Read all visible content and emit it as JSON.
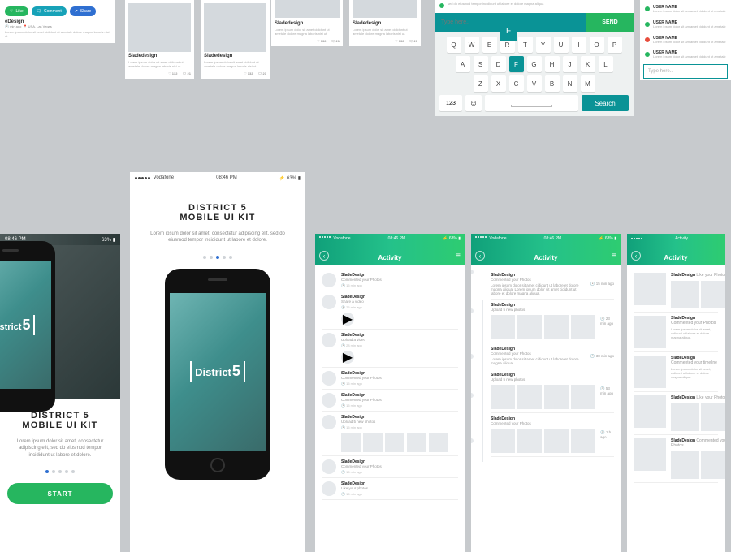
{
  "brand": {
    "name": "District",
    "num": "5",
    "kit_title_1": "DISTRICT 5",
    "kit_title_2": "MOBILE UI KIT",
    "lorem": "Lorem ipsum dolor sit amet, consectetur adipiscing elit, sed do eiusmod tempor incididunt ut labore et dolore.",
    "start": "START"
  },
  "status": {
    "carrier": "Vodafone",
    "time": "08:46 PM",
    "battery": "63%"
  },
  "social": {
    "like": "Like",
    "comment": "Comment",
    "share": "Share",
    "author": "Sladedesign",
    "title2": "eDesign",
    "when": "min ago",
    "loc": "USA, Las Vegas",
    "lorem": "Lorem ipsum dolor sit amet cididunt ut ametale dolore magna laboris nisi ut.",
    "likes": "132",
    "cmts": "21"
  },
  "chat": {
    "placeholder": "Type here..",
    "send": "SEND",
    "lorem": "sed do eiusmod tempor incididunt ut labore et dolore magna aliqua",
    "search": "Search",
    "num": "123"
  },
  "kbd": {
    "r1": [
      "Q",
      "W",
      "E",
      "R",
      "T",
      "Y",
      "U",
      "I",
      "O",
      "P"
    ],
    "r2": [
      "A",
      "S",
      "D",
      "F",
      "G",
      "H",
      "J",
      "K",
      "L"
    ],
    "r3": [
      "Z",
      "X",
      "C",
      "V",
      "B",
      "N",
      "M"
    ],
    "pop": "F"
  },
  "userlist": [
    {
      "name": "USER NAME",
      "dot": "g"
    },
    {
      "name": "USER NAME",
      "dot": "g"
    },
    {
      "name": "USER NAME",
      "dot": "r"
    },
    {
      "name": "USER NAME",
      "dot": "g"
    }
  ],
  "ul_lorem": "Lorem ipsum dolor sit am amet cididunt ut ametale",
  "ul_type": "Type here..",
  "activity": {
    "title": "Activity",
    "v1": [
      {
        "n": "SladeDesign",
        "a": "Commented your Photos",
        "t": "15 min ago"
      },
      {
        "n": "SladeDesign",
        "a": "Share a video",
        "t": "25 min ago"
      },
      {
        "n": "SladeDesign",
        "a": "Upload a video",
        "t": "28 min ago"
      },
      {
        "n": "SladeDesign",
        "a": "Commented your Photos",
        "t": "15 min ago"
      },
      {
        "n": "SladeDesign",
        "a": "Commented your Photos",
        "t": "15 min ago"
      },
      {
        "n": "SladeDesign",
        "a": "Upload 5 new photos",
        "t": "15 min ago"
      },
      {
        "n": "SladeDesign",
        "a": "Commented your Photos",
        "t": "15 min ago"
      },
      {
        "n": "SladeDesign",
        "a": "Like your photos",
        "t": "15 min ago"
      }
    ],
    "v2": [
      {
        "n": "SladeDesign",
        "a": "Commented your Photos",
        "r": "15 min ago",
        "lorem": "Lorem ipsum dolor sit amet cididunt ut labore et dolore magna aliqua. Lorem ipsum dolor sit amet cididunt ut labore et dolore magna aliqua."
      },
      {
        "n": "SladeDesign",
        "a": "Upload 5 new photos",
        "r": "23 min ago"
      },
      {
        "n": "SladeDesign",
        "a": "Commented your Photos",
        "r": "38 min ago",
        "lorem": "Lorem ipsum dolor sit amet cididunt ut labore et dolore magna aliqua."
      },
      {
        "n": "SladeDesign",
        "a": "Upload 5 new photos",
        "r": "53 min ago"
      },
      {
        "n": "SladeDesign",
        "a": "Commented your Photos",
        "r": "1 h ago"
      }
    ],
    "v3": [
      {
        "n": "SladeDesign",
        "a": "Like your Photos"
      },
      {
        "n": "SladeDesign",
        "a": "Commented your Photos",
        "lorem": "Lorem ipsum dolor sit amet, cididunt ut labore et dolore magna aliqua."
      },
      {
        "n": "SladeDesign",
        "a": "Commented your timeline",
        "lorem": "Lorem ipsum dolor sit amet, cididunt ut labore et dolore magna aliqua."
      },
      {
        "n": "SladeDesign",
        "a": "Like your Photos"
      },
      {
        "n": "SladeDesign",
        "a": "Commented your Photos"
      }
    ]
  }
}
